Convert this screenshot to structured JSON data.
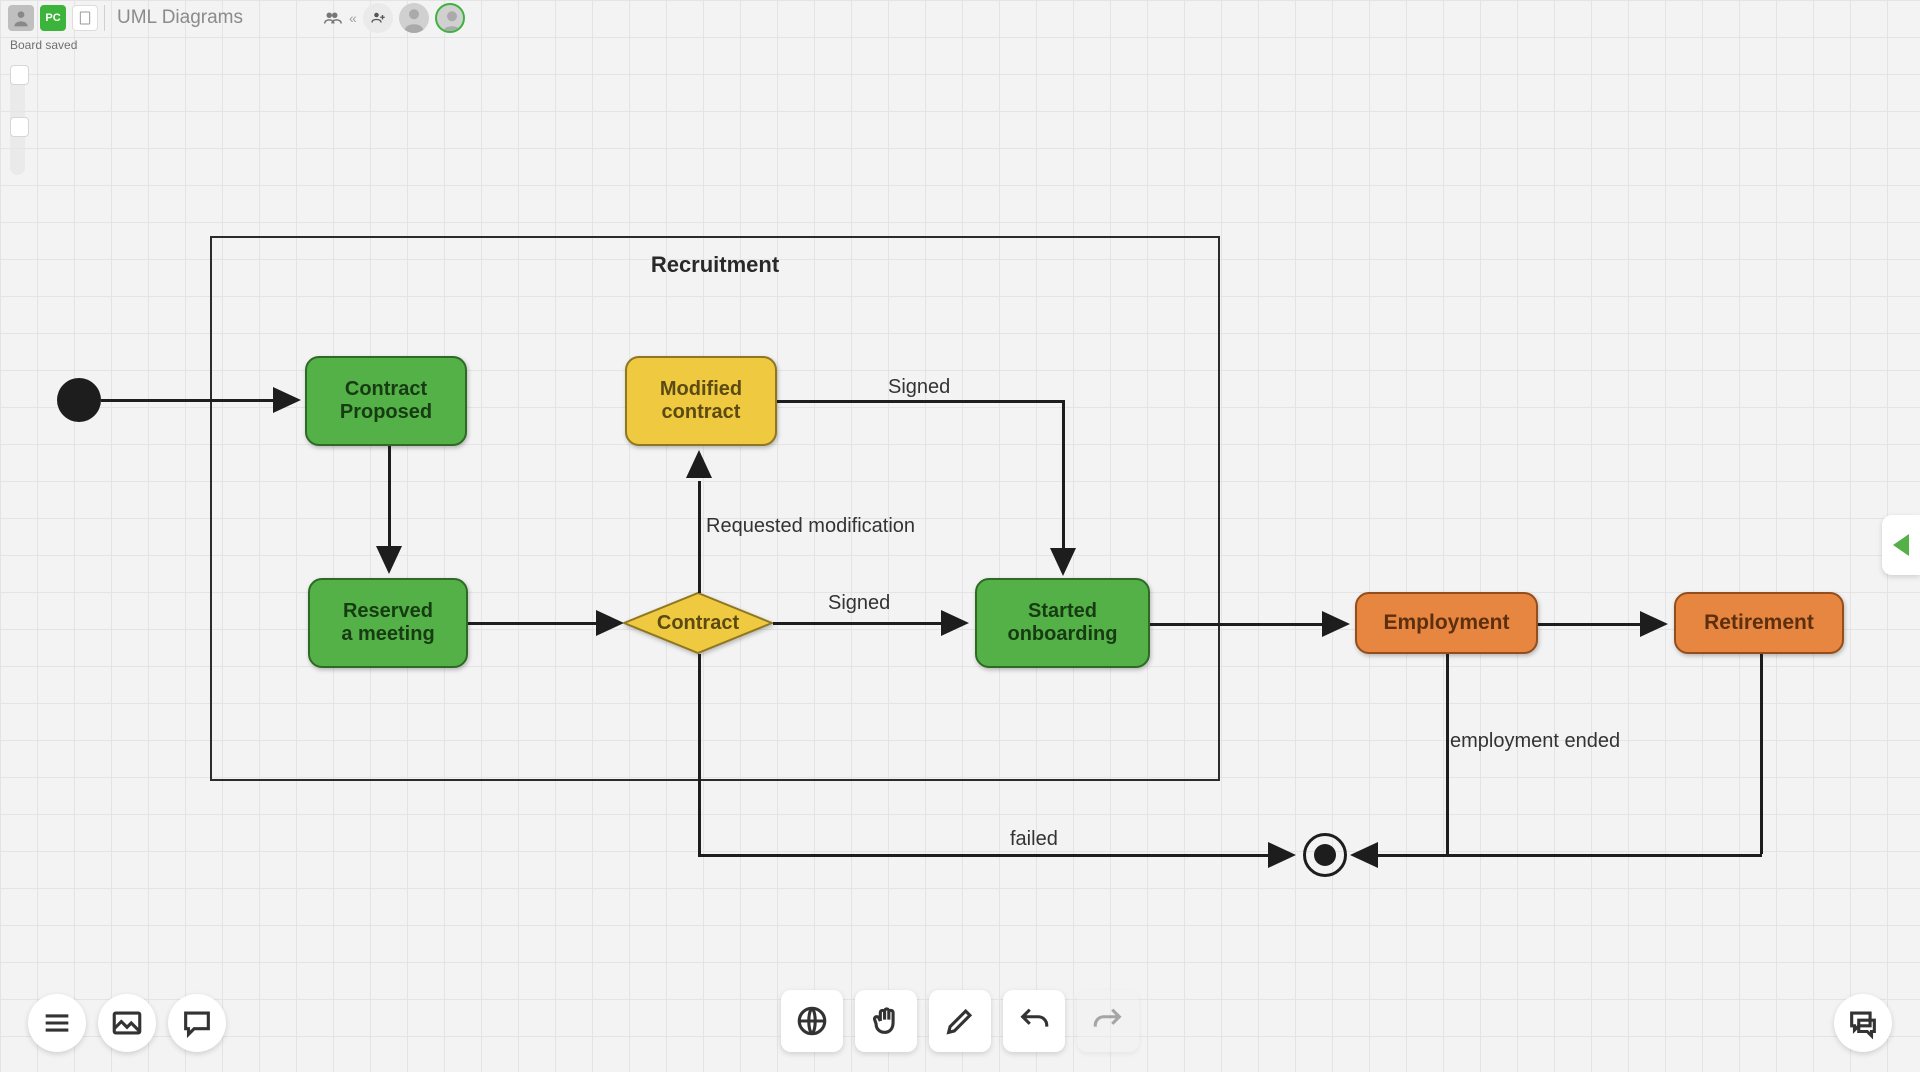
{
  "header": {
    "title": "UML Diagrams",
    "initials": "PC",
    "initials_bg": "#3cb43c",
    "save_status": "Board saved"
  },
  "diagram": {
    "frame_title": "Recruitment",
    "nodes": {
      "contract_proposed": "Contract\nProposed",
      "modified_contract": "Modified\ncontract",
      "reserved_meeting": "Reserved\na meeting",
      "contract": "Contract",
      "started_onboarding": "Started\nonboarding",
      "employment": "Employment",
      "retirement": "Retirement"
    },
    "edges": {
      "signed_top": "Signed",
      "requested_mod": "Requested modification",
      "signed_mid": "Signed",
      "employment_ended": "employment ended",
      "failed": "failed"
    }
  },
  "tools": {
    "bottom_left": [
      "menu",
      "image",
      "comment"
    ],
    "bottom_center": [
      "globe",
      "hand",
      "edit",
      "undo",
      "redo"
    ],
    "bottom_right": [
      "chat"
    ]
  },
  "icon_names": {
    "blank": "blank-page-icon",
    "group": "group-icon",
    "add_user": "add-user-icon",
    "globe": "globe-icon",
    "hand": "hand-icon",
    "edit": "pencil-icon",
    "undo": "undo-icon",
    "redo": "redo-icon",
    "menu": "menu-icon",
    "image": "image-icon",
    "comment": "comment-icon",
    "chat": "chat-icon",
    "collapse": "collapse-icon"
  },
  "colors": {
    "green": "#54b147",
    "yellow": "#efc93f",
    "orange": "#e78640"
  }
}
